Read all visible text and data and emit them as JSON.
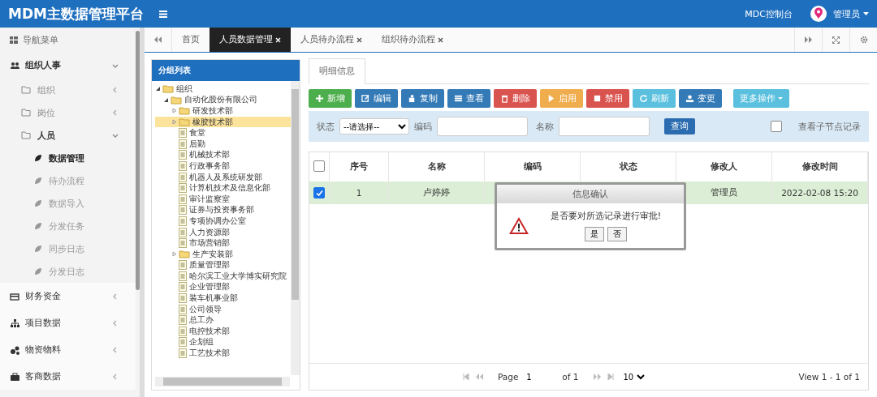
{
  "header": {
    "title": "MDM主数据管理平台",
    "console_link": "MDC控制台",
    "user": "管理员"
  },
  "sidebar": {
    "title": "导航菜单",
    "items": [
      {
        "label": "组织人事",
        "expanded": true,
        "children": [
          {
            "label": "组织",
            "expanded": false
          },
          {
            "label": "岗位",
            "expanded": false
          },
          {
            "label": "人员",
            "expanded": true,
            "children": [
              {
                "label": "数据管理",
                "selected": true
              },
              {
                "label": "待办流程",
                "selected": false
              },
              {
                "label": "数据导入",
                "selected": false
              },
              {
                "label": "分发任务",
                "selected": false
              },
              {
                "label": "同步日志",
                "selected": false
              },
              {
                "label": "分发日志",
                "selected": false
              }
            ]
          }
        ]
      },
      {
        "label": "财务资金",
        "expanded": false
      },
      {
        "label": "项目数据",
        "expanded": false
      },
      {
        "label": "物资物料",
        "expanded": false
      },
      {
        "label": "客商数据",
        "expanded": false
      }
    ]
  },
  "tabs": [
    {
      "label": "首页",
      "closable": false,
      "selected": false
    },
    {
      "label": "人员数据管理",
      "closable": true,
      "selected": true
    },
    {
      "label": "人员待办流程",
      "closable": true,
      "selected": false
    },
    {
      "label": "组织待办流程",
      "closable": true,
      "selected": false
    }
  ],
  "tree": {
    "title": "分组列表",
    "nodes": [
      {
        "label": "组织",
        "kind": "folder",
        "expanded": true,
        "selected": false,
        "children": [
          {
            "label": "自动化股份有限公司",
            "kind": "folder",
            "expanded": true,
            "selected": false,
            "children": [
              {
                "label": "研发技术部",
                "kind": "folder",
                "expanded": false,
                "selected": false
              },
              {
                "label": "橡胶技术部",
                "kind": "folder",
                "expanded": false,
                "selected": true
              },
              {
                "label": "食堂",
                "kind": "file",
                "selected": false
              },
              {
                "label": "后勤",
                "kind": "file",
                "selected": false
              },
              {
                "label": "机械技术部",
                "kind": "file",
                "selected": false
              },
              {
                "label": "行政事务部",
                "kind": "file",
                "selected": false
              },
              {
                "label": "机器人及系统研发部",
                "kind": "file",
                "selected": false
              },
              {
                "label": "计算机技术及信息化部",
                "kind": "file",
                "selected": false
              },
              {
                "label": "审计监察室",
                "kind": "file",
                "selected": false
              },
              {
                "label": "证券与投资事务部",
                "kind": "file",
                "selected": false
              },
              {
                "label": "专项协调办公室",
                "kind": "file",
                "selected": false
              },
              {
                "label": "人力资源部",
                "kind": "file",
                "selected": false
              },
              {
                "label": "市场营销部",
                "kind": "file",
                "selected": false
              },
              {
                "label": "生产安装部",
                "kind": "folder",
                "expanded": false,
                "selected": false
              },
              {
                "label": "质量管理部",
                "kind": "file",
                "selected": false
              },
              {
                "label": "哈尔滨工业大学博实研究院",
                "kind": "file",
                "selected": false
              },
              {
                "label": "企业管理部",
                "kind": "file",
                "selected": false
              },
              {
                "label": "装车机事业部",
                "kind": "file",
                "selected": false
              },
              {
                "label": "公司领导",
                "kind": "file",
                "selected": false
              },
              {
                "label": "总工办",
                "kind": "file",
                "selected": false
              },
              {
                "label": "电控技术部",
                "kind": "file",
                "selected": false
              },
              {
                "label": "企划组",
                "kind": "file",
                "selected": false
              },
              {
                "label": "工艺技术部",
                "kind": "file",
                "selected": false
              }
            ]
          }
        ]
      }
    ]
  },
  "detail_tab": "明细信息",
  "toolbar": [
    {
      "label": "新增",
      "color": "#4cae4c"
    },
    {
      "label": "编辑",
      "color": "#337ab7"
    },
    {
      "label": "复制",
      "color": "#337ab7"
    },
    {
      "label": "查看",
      "color": "#337ab7"
    },
    {
      "label": "删除",
      "color": "#d9534f"
    },
    {
      "label": "启用",
      "color": "#f0ad4e"
    },
    {
      "label": "禁用",
      "color": "#d9534f"
    },
    {
      "label": "刷新",
      "color": "#5bc0de"
    },
    {
      "label": "变更",
      "color": "#337ab7"
    }
  ],
  "more_button": "更多操作",
  "filter": {
    "status_label": "状态",
    "status_value": "--请选择--",
    "code_label": "编码",
    "name_label": "名称",
    "query_button": "查询",
    "sub_nodes": {
      "label": "查看子节点记录",
      "checked": false
    }
  },
  "table": {
    "all_checked": false,
    "columns": [
      "序号",
      "名称",
      "编码",
      "状态",
      "修改人",
      "修改时间"
    ],
    "rows": [
      {
        "selected": true,
        "no": "1",
        "name": "卢婷婷",
        "modifier": "管理员",
        "modified": "2022-02-08 15:20"
      }
    ]
  },
  "pager": {
    "page_label": "Page",
    "page": "1",
    "of": "of 1",
    "page_size": "10",
    "view": "View 1 - 1 of 1"
  },
  "dialog": {
    "title": "信息确认",
    "message": "是否要对所选记录进行审批!",
    "buttons": [
      "是",
      "否"
    ]
  }
}
